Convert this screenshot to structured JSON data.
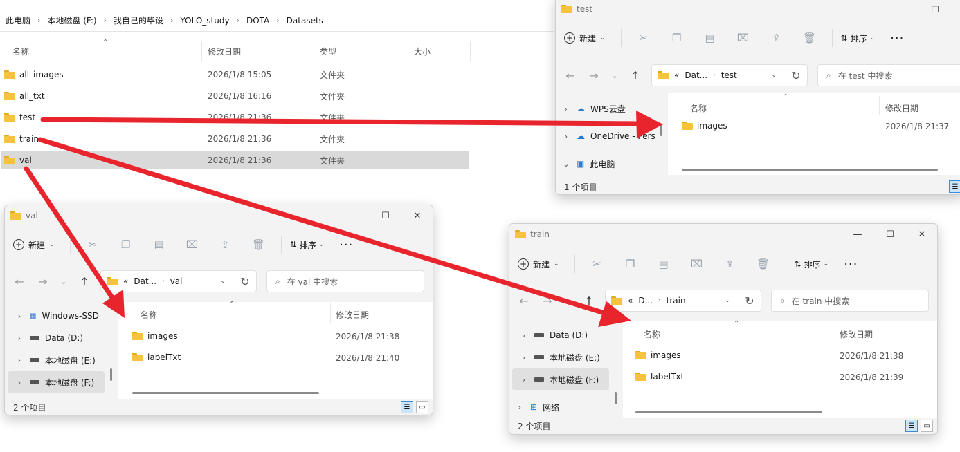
{
  "background": {
    "breadcrumb": [
      "此电脑",
      "本地磁盘 (F:)",
      "我自己的毕设",
      "YOLO_study",
      "DOTA",
      "Datasets"
    ],
    "columns": {
      "name": "名称",
      "date": "修改日期",
      "type": "类型",
      "size": "大小"
    },
    "rows": [
      {
        "name": "all_images",
        "date": "2026/1/8 15:05",
        "type": "文件夹"
      },
      {
        "name": "all_txt",
        "date": "2026/1/8 16:16",
        "type": "文件夹"
      },
      {
        "name": "test",
        "date": "2026/1/8 21:36",
        "type": "文件夹"
      },
      {
        "name": "train",
        "date": "2026/1/8 21:36",
        "type": "文件夹"
      },
      {
        "name": "val",
        "date": "2026/1/8 21:36",
        "type": "文件夹"
      }
    ]
  },
  "toolbar": {
    "new_label": "新建",
    "sort_label": "排序",
    "more_label": "···"
  },
  "test_window": {
    "title": "test",
    "addr_prefix": "«",
    "addr_parent": "Dat...",
    "addr_current": "test",
    "search_placeholder": "在 test 中搜索",
    "nav": [
      {
        "label": "WPS云盘",
        "icon": "cloud-icon"
      },
      {
        "label": "OneDrive - Pers",
        "icon": "onedrive-icon"
      },
      {
        "label": "此电脑",
        "icon": "computer-icon"
      }
    ],
    "columns": {
      "name": "名称",
      "date": "修改日期"
    },
    "items": [
      {
        "name": "images",
        "date": "2026/1/8 21:37"
      }
    ],
    "status": "1 个项目"
  },
  "val_window": {
    "title": "val",
    "addr_prefix": "«",
    "addr_parent": "Dat...",
    "addr_current": "val",
    "search_placeholder": "在 val 中搜索",
    "nav": [
      {
        "label": "Windows-SSD",
        "icon": "windows-drive-icon"
      },
      {
        "label": "Data (D:)",
        "icon": "drive-icon"
      },
      {
        "label": "本地磁盘 (E:)",
        "icon": "drive-icon"
      },
      {
        "label": "本地磁盘 (F:)",
        "icon": "drive-icon"
      }
    ],
    "columns": {
      "name": "名称",
      "date": "修改日期"
    },
    "items": [
      {
        "name": "images",
        "date": "2026/1/8 21:38"
      },
      {
        "name": "labelTxt",
        "date": "2026/1/8 21:40"
      }
    ],
    "status": "2 个项目"
  },
  "train_window": {
    "title": "train",
    "addr_prefix": "«",
    "addr_parent": "D...",
    "addr_current": "train",
    "search_placeholder": "在 train 中搜索",
    "nav": [
      {
        "label": "Data (D:)",
        "icon": "drive-icon"
      },
      {
        "label": "本地磁盘 (E:)",
        "icon": "drive-icon"
      },
      {
        "label": "本地磁盘 (F:)",
        "icon": "drive-icon"
      },
      {
        "label": "网络",
        "icon": "network-icon"
      }
    ],
    "columns": {
      "name": "名称",
      "date": "修改日期"
    },
    "items": [
      {
        "name": "images",
        "date": "2026/1/8 21:38"
      },
      {
        "name": "labelTxt",
        "date": "2026/1/8 21:39"
      }
    ],
    "status": "2 个项目"
  },
  "colors": {
    "arrow": "#e8242c",
    "folder": "#f7c23c",
    "selection": "#d9d9d9"
  }
}
